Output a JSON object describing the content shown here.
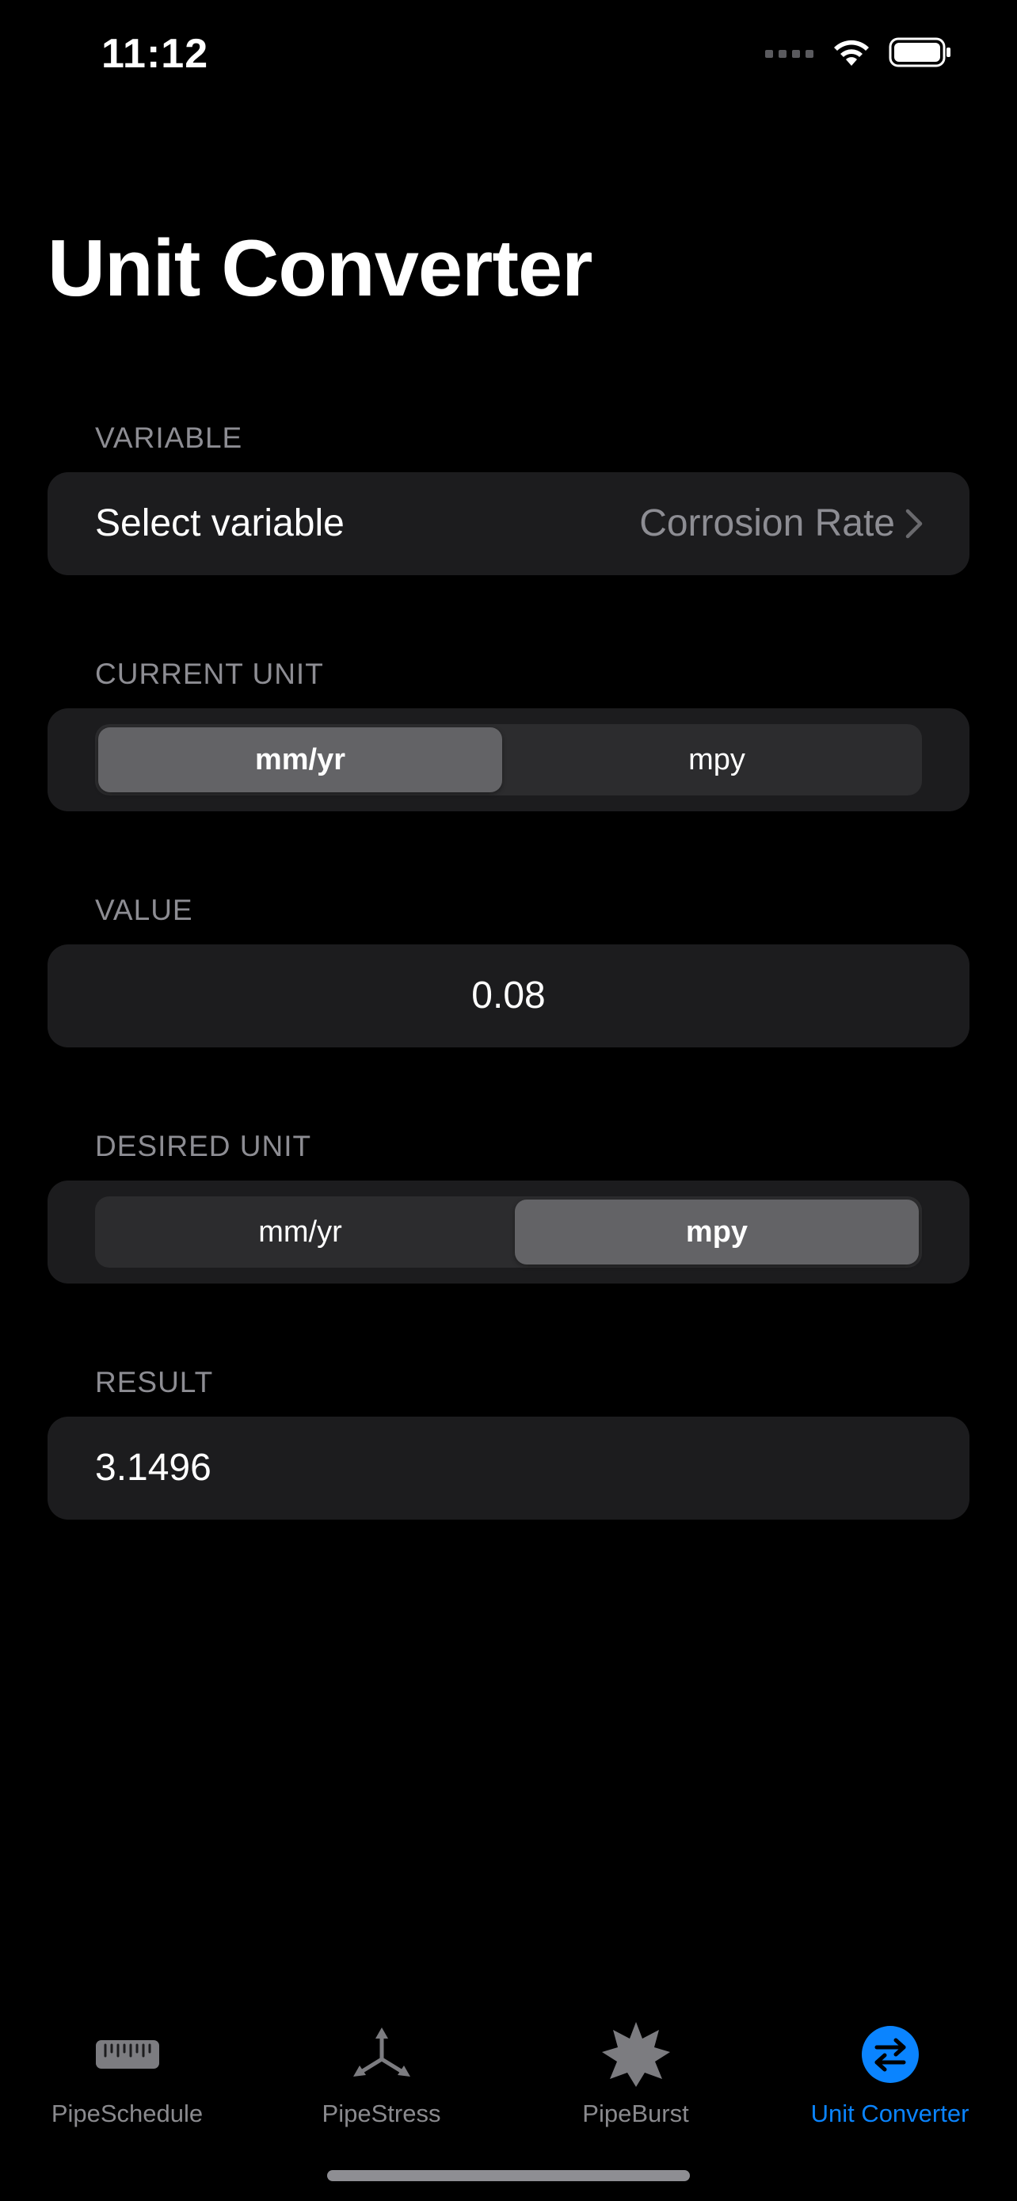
{
  "status_bar": {
    "time": "11:12"
  },
  "title": "Unit Converter",
  "variable": {
    "header": "VARIABLE",
    "label": "Select variable",
    "value": "Corrosion Rate"
  },
  "current_unit": {
    "header": "CURRENT UNIT",
    "options": [
      "mm/yr",
      "mpy"
    ],
    "selected": "mm/yr"
  },
  "value": {
    "header": "VALUE",
    "text": "0.08"
  },
  "desired_unit": {
    "header": "DESIRED UNIT",
    "options": [
      "mm/yr",
      "mpy"
    ],
    "selected": "mpy"
  },
  "result": {
    "header": "RESULT",
    "text": "3.1496"
  },
  "tabs": [
    {
      "label": "PipeSchedule",
      "icon": "ruler-icon",
      "active": false
    },
    {
      "label": "PipeStress",
      "icon": "stress-arrows-icon",
      "active": false
    },
    {
      "label": "PipeBurst",
      "icon": "burst-icon",
      "active": false
    },
    {
      "label": "Unit Converter",
      "icon": "convert-arrows-icon",
      "active": true
    }
  ],
  "colors": {
    "accent": "#0a84ff",
    "background": "#000000",
    "group": "#1c1c1e",
    "secondary_text": "#8d8d93"
  }
}
